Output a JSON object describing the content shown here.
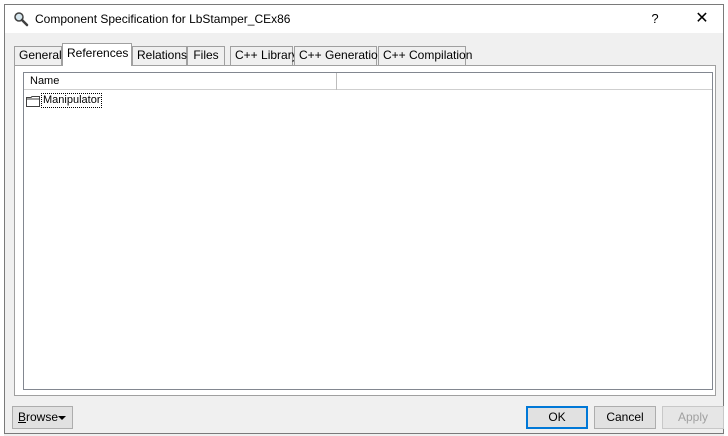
{
  "window": {
    "title": "Component Specification for LbStamper_CEx86",
    "help_label": "?",
    "close_label": "✕"
  },
  "tabs": [
    {
      "label": "General",
      "active": false
    },
    {
      "label": "References",
      "active": true
    },
    {
      "label": "Relations",
      "active": false
    },
    {
      "label": "Files",
      "active": false
    },
    {
      "label": "C++ Library",
      "active": false
    },
    {
      "label": "C++ Generation",
      "active": false
    },
    {
      "label": "C++ Compilation",
      "active": false
    }
  ],
  "tree": {
    "columns": [
      "Name",
      ""
    ],
    "items": [
      {
        "label": "Manipulator",
        "icon": "folder-icon"
      }
    ]
  },
  "buttons": {
    "browse_label_first": "B",
    "browse_label_rest": "rowse",
    "ok_label": "OK",
    "cancel_label": "Cancel",
    "apply_label": "Apply"
  }
}
